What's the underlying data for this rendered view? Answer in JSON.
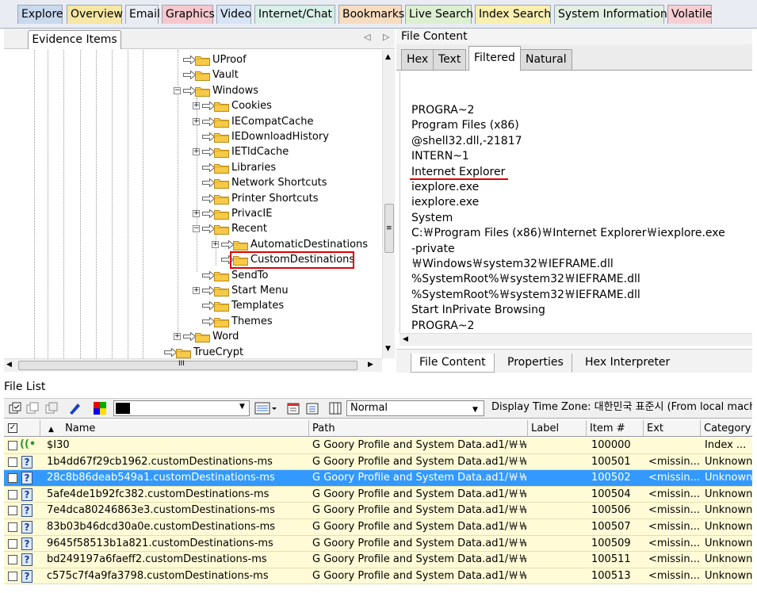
{
  "top_tabs": [
    {
      "label": "Explore",
      "bg": "#c9d9ee"
    },
    {
      "label": "Overview",
      "bg": "#f6e7a5"
    },
    {
      "label": "Email",
      "bg": "#e9edf3"
    },
    {
      "label": "Graphics",
      "bg": "#f6c7cc"
    },
    {
      "label": "Video",
      "bg": "#d6e4f7"
    },
    {
      "label": "Internet/Chat",
      "bg": "#d9f0e9"
    },
    {
      "label": "Bookmarks",
      "bg": "#f8dcc0"
    },
    {
      "label": "Live Search",
      "bg": "#dcefd0"
    },
    {
      "label": "Index Search",
      "bg": "#f8efb0"
    },
    {
      "label": "System Information",
      "bg": "#e3efe3"
    },
    {
      "label": "Volatile",
      "bg": "#f7cfd3"
    }
  ],
  "evidence": {
    "tab_label": "Evidence Items",
    "arrows": "◁ ▷",
    "tree": [
      {
        "label": "UProof",
        "expander": ""
      },
      {
        "label": "Vault",
        "expander": ""
      },
      {
        "label": "Windows",
        "expander": "−"
      },
      {
        "label": "Cookies",
        "expander": "+"
      },
      {
        "label": "IECompatCache",
        "expander": "+"
      },
      {
        "label": "IEDownloadHistory",
        "expander": ""
      },
      {
        "label": "IETldCache",
        "expander": "+"
      },
      {
        "label": "Libraries",
        "expander": ""
      },
      {
        "label": "Network Shortcuts",
        "expander": ""
      },
      {
        "label": "Printer Shortcuts",
        "expander": ""
      },
      {
        "label": "PrivacIE",
        "expander": "+"
      },
      {
        "label": "Recent",
        "expander": "−"
      },
      {
        "label": "AutomaticDestinations",
        "expander": "+"
      },
      {
        "label": "CustomDestinations",
        "expander": ""
      },
      {
        "label": "SendTo",
        "expander": ""
      },
      {
        "label": "Start Menu",
        "expander": "+"
      },
      {
        "label": "Templates",
        "expander": ""
      },
      {
        "label": "Themes",
        "expander": ""
      },
      {
        "label": "Word",
        "expander": "+"
      },
      {
        "label": "TrueCrypt",
        "expander": ""
      }
    ],
    "hscroll_grip": "III"
  },
  "file_content": {
    "title": "File Content",
    "tabs": [
      "Hex",
      "Text",
      "Filtered",
      "Natural"
    ],
    "active_tab": "Filtered",
    "lines": [
      "PROGRA~2",
      "Program Files (x86)",
      "@shell32.dll,-21817",
      "INTERN~1",
      "Internet Explorer",
      "iexplore.exe",
      "iexplore.exe",
      "System",
      "C:￦Program Files (x86)￦Internet Explorer￦iexplore.exe",
      "-private",
      "￦Windows￦system32￦IEFRAME.dll",
      " %SystemRoot%￦system32￦IEFRAME.dll",
      "%SystemRoot%￦system32￦IEFRAME.dll",
      "Start InPrivate Browsing",
      "PROGRA~2"
    ],
    "bottom_tabs": [
      "File Content",
      "Properties",
      "Hex Interpreter"
    ]
  },
  "file_list": {
    "label": "File List",
    "view_select": "Normal",
    "timezone": "Display Time Zone: 대한민국 표준시  (From local machi",
    "columns": [
      "Name",
      "Path",
      "Label",
      "Item #",
      "Ext",
      "Category"
    ],
    "rows": [
      {
        "name": "$I30",
        "path": "G Goory Profile and System Data.ad1/￦￦...",
        "label": "",
        "item": "100000",
        "ext": "",
        "category": "Index ..."
      },
      {
        "name": "1b4dd67f29cb1962.customDestinations-ms",
        "path": "G Goory Profile and System Data.ad1/￦￦...",
        "label": "",
        "item": "100501",
        "ext": "<missin...",
        "category": "Unknown"
      },
      {
        "name": "28c8b86deab549a1.customDestinations-ms",
        "path": "G Goory Profile and System Data.ad1/￦￦...",
        "label": "",
        "item": "100502",
        "ext": "<missin...",
        "category": "Unknown"
      },
      {
        "name": "5afe4de1b92fc382.customDestinations-ms",
        "path": "G Goory Profile and System Data.ad1/￦￦...",
        "label": "",
        "item": "100504",
        "ext": "<missin...",
        "category": "Unknown"
      },
      {
        "name": "7e4dca80246863e3.customDestinations-ms",
        "path": "G Goory Profile and System Data.ad1/￦￦...",
        "label": "",
        "item": "100506",
        "ext": "<missin...",
        "category": "Unknown"
      },
      {
        "name": "83b03b46dcd30a0e.customDestinations-ms",
        "path": "G Goory Profile and System Data.ad1/￦￦...",
        "label": "",
        "item": "100507",
        "ext": "<missin...",
        "category": "Unknown"
      },
      {
        "name": "9645f58513b1a821.customDestinations-ms",
        "path": "G Goory Profile and System Data.ad1/￦￦...",
        "label": "",
        "item": "100509",
        "ext": "<missin...",
        "category": "Unknown"
      },
      {
        "name": "bd249197a6faeff2.customDestinations-ms",
        "path": "G Goory Profile and System Data.ad1/￦￦...",
        "label": "",
        "item": "100511",
        "ext": "<missin...",
        "category": "Unknown"
      },
      {
        "name": "c575c7f4a9fa3798.customDestinations-ms",
        "path": "G Goory Profile and System Data.ad1/￦￦...",
        "label": "",
        "item": "100513",
        "ext": "<missin...",
        "category": "Unknown"
      }
    ],
    "selected_row": 2,
    "selection_color": "#3399ff",
    "row_color": "#fffbd6"
  },
  "colors": {
    "highlight_red": "#e00000"
  }
}
